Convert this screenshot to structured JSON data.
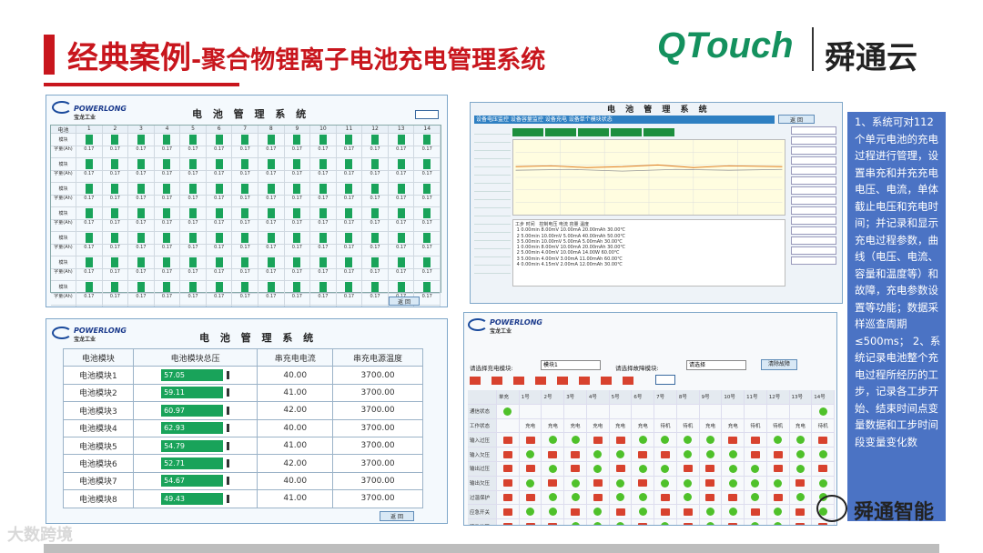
{
  "header": {
    "title": "经典案例",
    "title_sub": "-聚合物锂离子电池充电管理系统",
    "logo_en": "QTouch",
    "logo_cn": "舜通云"
  },
  "panel_common": {
    "brand": "POWERLONG",
    "brand_cn": "宝龙工业",
    "title": "电 池 管 理 系 统"
  },
  "panel1": {
    "header": [
      "电池",
      "1",
      "2",
      "3",
      "4",
      "5",
      "6",
      "7",
      "8",
      "9",
      "10",
      "11",
      "12",
      "13",
      "14"
    ],
    "row_labels": [
      "模块",
      "字量(Ah)",
      "字量(Ah)",
      "字量(Ah)",
      "字量(Ah)",
      "字量(Ah)",
      "字量(Ah)",
      "字量(Ah)",
      "字量(Ah)"
    ],
    "rows": [
      [
        "0.17",
        "0.17",
        "0.17",
        "0.17",
        "0.17",
        "0.17",
        "0.17",
        "0.17",
        "0.17",
        "0.17",
        "0.17",
        "0.17",
        "0.17",
        "0.17"
      ],
      [
        "0.17",
        "0.17",
        "0.17",
        "0.17",
        "0.17",
        "0.17",
        "0.17",
        "0.17",
        "0.17",
        "0.17",
        "0.17",
        "0.17",
        "0.17",
        "0.17"
      ],
      [
        "0.17",
        "0.17",
        "0.17",
        "0.17",
        "0.17",
        "0.17",
        "0.17",
        "0.17",
        "0.17",
        "0.17",
        "0.17",
        "0.17",
        "0.17",
        "0.17"
      ],
      [
        "0.17",
        "0.17",
        "0.17",
        "0.17",
        "0.17",
        "0.17",
        "0.17",
        "0.17",
        "0.17",
        "0.17",
        "0.17",
        "0.17",
        "0.17",
        "0.17"
      ],
      [
        "0.17",
        "0.17",
        "0.17",
        "0.17",
        "0.17",
        "0.17",
        "0.17",
        "0.17",
        "0.17",
        "0.17",
        "0.17",
        "0.17",
        "0.17",
        "0.17"
      ],
      [
        "0.17",
        "0.17",
        "0.17",
        "0.17",
        "0.17",
        "0.17",
        "0.17",
        "0.17",
        "0.17",
        "0.17",
        "0.17",
        "0.17",
        "0.17",
        "0.17"
      ],
      [
        "0.17",
        "0.17",
        "0.17",
        "0.17",
        "0.17",
        "0.17",
        "0.17",
        "0.17",
        "0.17",
        "0.17",
        "0.17",
        "0.17",
        "0.17",
        "0.17"
      ],
      [
        "0.17",
        "0.17",
        "0.17",
        "0.17",
        "0.17",
        "0.17",
        "0.17",
        "0.17",
        "0.17",
        "0.17",
        "0.17",
        "0.17",
        "0.17",
        "0.17"
      ]
    ],
    "button": "返 回"
  },
  "panel2": {
    "tabs": "设备电压监控 设备容量监控 设备充电 设备单个模块状态",
    "button": "返 回",
    "log": "工步 时间   控制电压 电流 容量 温度\n 1 0.00min 8.00mV 10.00mA 20.00mAh 30.00℃\n 2 5.00min 10.00mV 5.00mA 40.00mAh 50.00℃\n 3 5.00min 10.00mV 5.00mA 5.00mAh 30.00℃\n 1 0.00min 8.00mV 10.00mA 20.00mAh 30.00℃\n 2 5.00min 4.00mV 10.00mA 14.00W 60.00℃\n 3 5.00min 4.00mV 3.00mA 11.00mAh 60.00℃\n 4 0.00min 4.15mV 2.00mA 12.00mAh 30.00℃"
  },
  "panel3": {
    "headers": [
      "电池模块",
      "电池模块总压",
      "串充电电流",
      "串充电源温度"
    ],
    "rows": [
      {
        "name": "电池模块1",
        "voltage": "57.05",
        "current": "40.00",
        "temp": "3700.00"
      },
      {
        "name": "电池模块2",
        "voltage": "59.11",
        "current": "41.00",
        "temp": "3700.00"
      },
      {
        "name": "电池模块3",
        "voltage": "60.97",
        "current": "42.00",
        "temp": "3700.00"
      },
      {
        "name": "电池模块4",
        "voltage": "62.93",
        "current": "40.00",
        "temp": "3700.00"
      },
      {
        "name": "电池模块5",
        "voltage": "54.79",
        "current": "41.00",
        "temp": "3700.00"
      },
      {
        "name": "电池模块6",
        "voltage": "52.71",
        "current": "42.00",
        "temp": "3700.00"
      },
      {
        "name": "电池模块7",
        "voltage": "54.67",
        "current": "40.00",
        "temp": "3700.00"
      },
      {
        "name": "电池模块8",
        "voltage": "49.43",
        "current": "41.00",
        "temp": "3700.00"
      }
    ],
    "button": "返 回"
  },
  "panel4": {
    "label1": "请选择充电模块:",
    "select1": "模块1",
    "label2": "请选择故障模块:",
    "select2": "请选择",
    "clear_button": "清除故障",
    "cols": [
      "",
      "单充",
      "1号",
      "2号",
      "3号",
      "4号",
      "5号",
      "6号",
      "7号",
      "8号",
      "9号",
      "10号",
      "11号",
      "12号",
      "13号",
      "14号"
    ],
    "row_labels": [
      "通信状态",
      "工作状态",
      "输入过压",
      "输入欠压",
      "输出过压",
      "输出欠压",
      "过温保护",
      "应急开关",
      "硬件故障"
    ],
    "work_state": [
      "充电",
      "充电",
      "充电",
      "充电",
      "充电",
      "充电",
      "待机",
      "待机",
      "充电",
      "充电",
      "待机",
      "待机",
      "充电",
      "待机"
    ]
  },
  "note": "1、系统可对112个单元电池的充电过程进行管理，设置串充和并充充电电压、电流，单体截止电压和充电时间；并记录和显示充电过程参数，曲线（电压、电流、容量和温度等）和故障，充电参数设置等功能；数据采样巡查周期≤500ms；\n2、系统记录电池整个充电过程所经历的工步，记录各工步开始、结束时间点变量数据和工步时间段变量变化数",
  "watermark_left": "大数跨境",
  "watermark_right": "舜通智能"
}
